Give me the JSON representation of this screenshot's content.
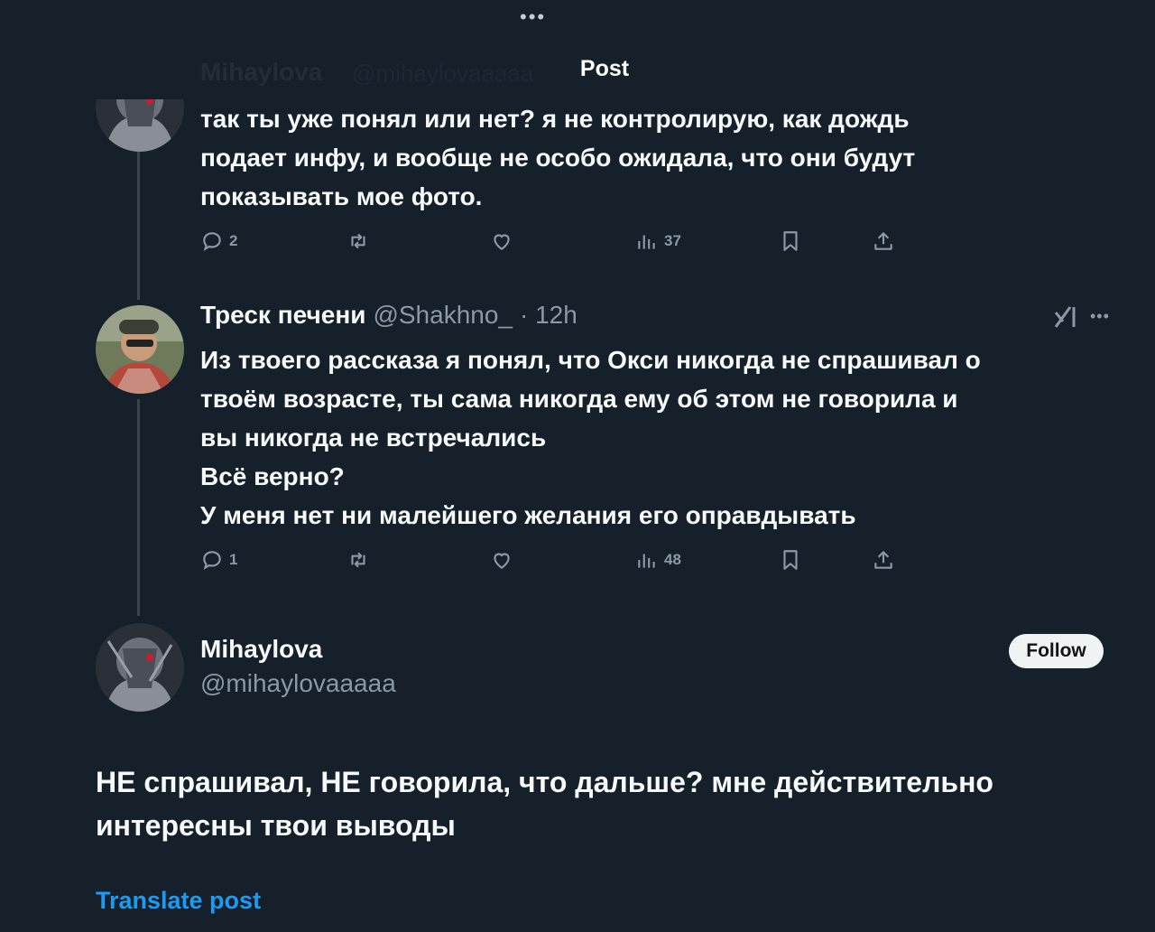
{
  "header": {
    "title": "Post",
    "more_dots": "•••",
    "ghost_name": "Mihaylova",
    "ghost_handle": "@mihaylovaaaaa"
  },
  "tweets": [
    {
      "text_lines": [
        "так ты уже понял или нет? я не контролирую, как дождь",
        "подает инфу, и вообще не особо ожидала, что они будут",
        "показывать мое фото."
      ],
      "actions": {
        "replies": "2",
        "reposts": "",
        "likes": "",
        "views": "37"
      }
    },
    {
      "author": "Треск печени",
      "handle": "@Shakhno_",
      "time": "· 12h",
      "text_lines": [
        "Из твоего рассказа я понял, что Окси никогда  не спрашивал о",
        "твоём возрасте, ты сама никогда ему об этом не говорила и",
        "вы никогда не встречались",
        "Всё верно?",
        "У меня нет ни малейшего желания его оправдывать"
      ],
      "actions": {
        "replies": "1",
        "reposts": "",
        "likes": "",
        "views": "48"
      },
      "more_label": "•••"
    }
  ],
  "main_post": {
    "author": "Mihaylova",
    "handle": "@mihaylovaaaaa",
    "follow_label": "Follow",
    "text_lines": [
      "НЕ спрашивал, НЕ говорила, что дальше? мне действительно",
      "интересны твои выводы"
    ],
    "translate_label": "Translate post"
  },
  "colors": {
    "background": "#15202b",
    "text": "#f7f9f9",
    "secondary": "#8b98a5",
    "accent": "#1d9bf0"
  }
}
